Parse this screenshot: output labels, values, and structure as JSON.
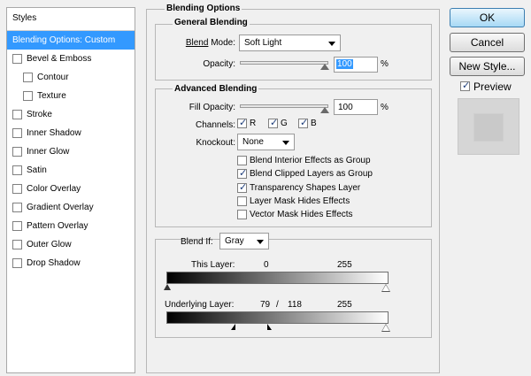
{
  "styles_panel": {
    "header": "Styles",
    "items": [
      {
        "label": "Blending Options: Custom",
        "selected": true
      },
      {
        "label": "Bevel & Emboss",
        "checked": false
      },
      {
        "label": "Contour",
        "checked": false,
        "indent": true
      },
      {
        "label": "Texture",
        "checked": false,
        "indent": true
      },
      {
        "label": "Stroke",
        "checked": false
      },
      {
        "label": "Inner Shadow",
        "checked": false
      },
      {
        "label": "Inner Glow",
        "checked": false
      },
      {
        "label": "Satin",
        "checked": false
      },
      {
        "label": "Color Overlay",
        "checked": false
      },
      {
        "label": "Gradient Overlay",
        "checked": false
      },
      {
        "label": "Pattern Overlay",
        "checked": false
      },
      {
        "label": "Outer Glow",
        "checked": false
      },
      {
        "label": "Drop Shadow",
        "checked": false
      }
    ]
  },
  "blending_options": {
    "title": "Blending Options",
    "general": {
      "title": "General Blending",
      "blend_mode_label": "Blend Mode:",
      "blend_mode_value": "Soft Light",
      "opacity_label": "Opacity:",
      "opacity_value": "100",
      "opacity_unit": "%"
    },
    "advanced": {
      "title": "Advanced Blending",
      "fill_opacity_label": "Fill Opacity:",
      "fill_opacity_value": "100",
      "fill_opacity_unit": "%",
      "channels_label": "Channels:",
      "channels": [
        {
          "label": "R",
          "checked": true
        },
        {
          "label": "G",
          "checked": true
        },
        {
          "label": "B",
          "checked": true
        }
      ],
      "knockout_label": "Knockout:",
      "knockout_value": "None",
      "options": [
        {
          "label": "Blend Interior Effects as Group",
          "checked": false
        },
        {
          "label": "Blend Clipped Layers as Group",
          "checked": true
        },
        {
          "label": "Transparency Shapes Layer",
          "checked": true
        },
        {
          "label": "Layer Mask Hides Effects",
          "checked": false
        },
        {
          "label": "Vector Mask Hides Effects",
          "checked": false
        }
      ]
    },
    "blend_if": {
      "label": "Blend If:",
      "value": "Gray",
      "this_layer": {
        "label": "This Layer:",
        "low": "0",
        "high": "255"
      },
      "underlying_layer": {
        "label": "Underlying Layer:",
        "low": "79",
        "sep": "/",
        "low2": "118",
        "high": "255"
      }
    }
  },
  "buttons": {
    "ok": "OK",
    "cancel": "Cancel",
    "new_style": "New Style...",
    "preview_label": "Preview",
    "preview_checked": true
  }
}
